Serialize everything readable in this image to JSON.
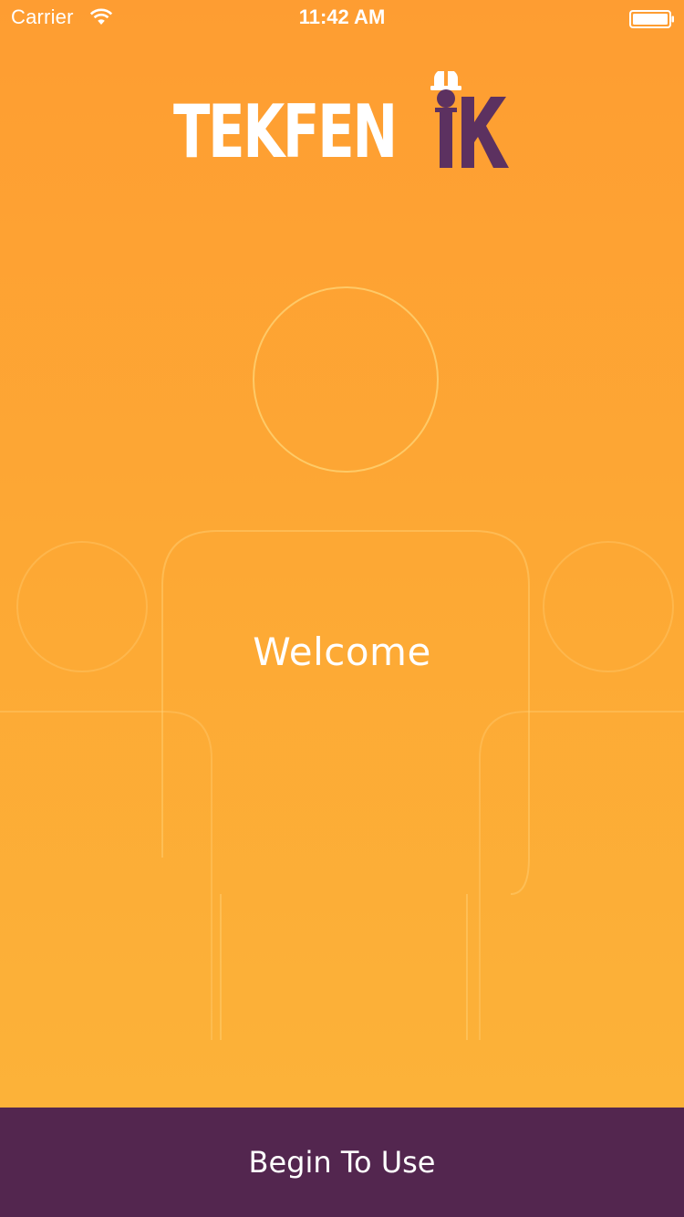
{
  "status_bar": {
    "carrier": "Carrier",
    "time": "11:42 AM",
    "wifi_icon": "wifi-icon",
    "battery_icon": "battery-full-icon"
  },
  "logo": {
    "text": "TEKFEN",
    "worker_icon": "hardhat-worker-icon",
    "text_color": "#ffffff",
    "accent_color": "#5c3160"
  },
  "main": {
    "welcome": "Welcome"
  },
  "footer": {
    "button_label": "Begin To Use",
    "background_color": "#53264f"
  },
  "colors": {
    "gradient_top": "#fe9d32",
    "gradient_bottom": "#fcb43a"
  }
}
